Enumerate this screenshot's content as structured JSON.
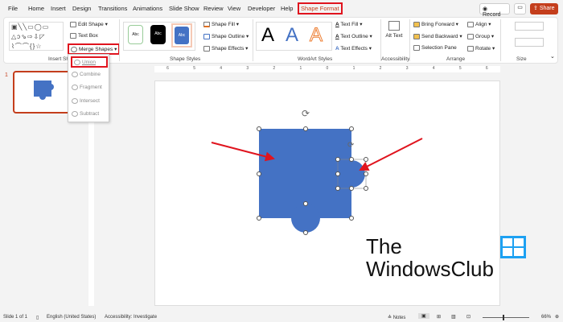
{
  "tabs": [
    "File",
    "Home",
    "Insert",
    "Design",
    "Transitions",
    "Animations",
    "Slide Show",
    "Review",
    "View",
    "Developer",
    "Help",
    "Shape Format"
  ],
  "active_tab": "Shape Format",
  "top_right": {
    "record": "Record",
    "share": "Share"
  },
  "ribbon": {
    "insert_shapes": {
      "label": "Insert Shapes",
      "edit_shape": "Edit Shape",
      "text_box": "Text Box",
      "merge_shapes": "Merge Shapes"
    },
    "shape_styles": {
      "label": "Shape Styles",
      "presets": [
        "Abc",
        "Abc",
        "Abc"
      ],
      "shape_fill": "Shape Fill",
      "shape_outline": "Shape Outline",
      "shape_effects": "Shape Effects"
    },
    "wordart": {
      "label": "WordArt Styles",
      "presets": [
        "A",
        "A",
        "A"
      ],
      "text_fill": "Text Fill",
      "text_outline": "Text Outline",
      "text_effects": "Text Effects"
    },
    "accessibility": {
      "label": "Accessibility",
      "alt_text": "Alt Text"
    },
    "arrange": {
      "label": "Arrange",
      "bring_forward": "Bring Forward",
      "send_backward": "Send Backward",
      "selection_pane": "Selection Pane",
      "align": "Align",
      "group": "Group",
      "rotate": "Rotate"
    },
    "size": {
      "label": "Size"
    }
  },
  "merge_menu": [
    "Union",
    "Combine",
    "Fragment",
    "Intersect",
    "Subtract"
  ],
  "ruler": [
    "6",
    "5",
    "4",
    "3",
    "2",
    "1",
    "0",
    "1",
    "2",
    "3",
    "4",
    "5",
    "6"
  ],
  "thumbnail_number": "1",
  "logo": {
    "line1": "The",
    "line2": "WindowsClub"
  },
  "status": {
    "slide": "Slide 1 of 1",
    "language": "English (United States)",
    "accessibility": "Accessibility: Investigate",
    "notes": "Notes",
    "zoom": "66%"
  },
  "colors": {
    "shape": "#4472c4",
    "accent": "#c43e1c",
    "highlight": "#e0141e"
  }
}
